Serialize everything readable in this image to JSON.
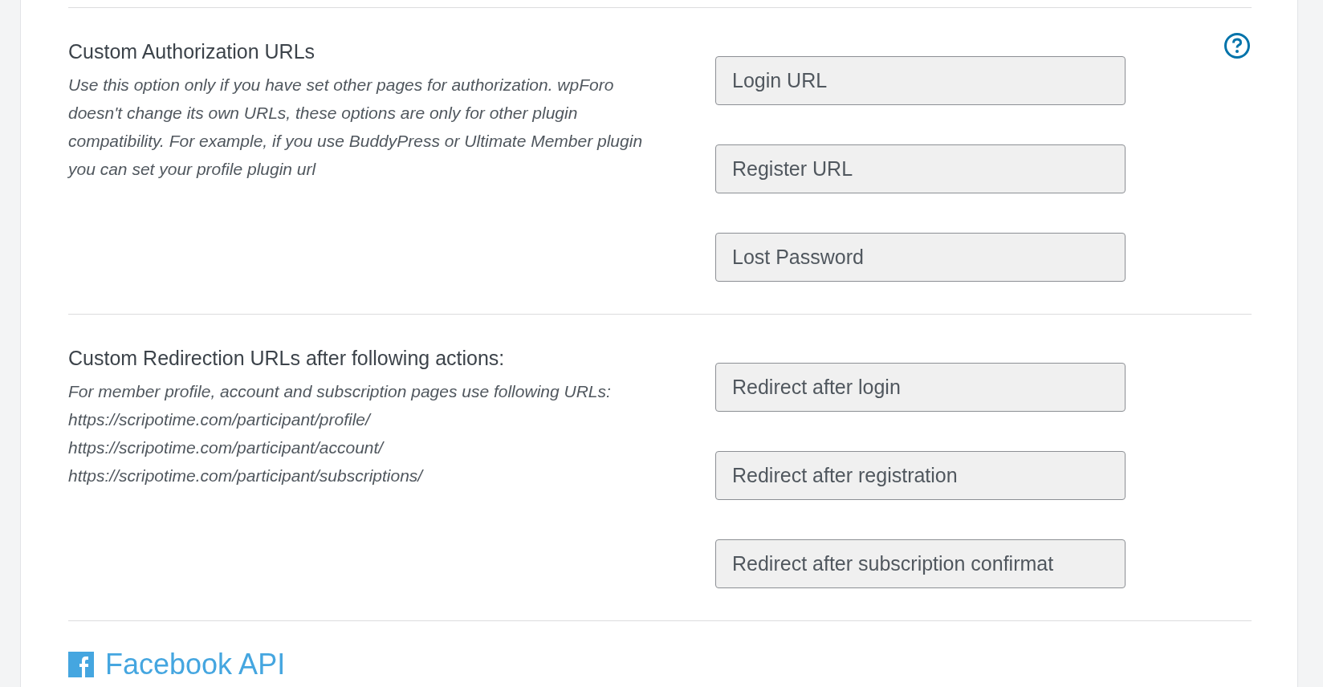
{
  "sections": [
    {
      "title": "Custom Authorization URLs",
      "description": "Use this option only if you have set other pages for authorization. wpForo doesn't change its own URLs, these options are only for other plugin compatibility. For example, if you use BuddyPress or Ultimate Member plugin you can set your profile plugin url",
      "help": true,
      "fields": [
        {
          "value": "Login URL"
        },
        {
          "value": "Register URL"
        },
        {
          "value": "Lost Password"
        }
      ]
    },
    {
      "title": "Custom Redirection URLs after following actions:",
      "description_lines": [
        "For member profile, account and subscription pages use following URLs:",
        "https://scripotime.com/participant/profile/",
        "https://scripotime.com/participant/account/",
        "https://scripotime.com/participant/subscriptions/"
      ],
      "help": false,
      "fields": [
        {
          "value": "Redirect after login"
        },
        {
          "value": "Redirect after registration"
        },
        {
          "value": "Redirect after subscription confirmat"
        }
      ]
    }
  ],
  "next_section": {
    "title": "Facebook API"
  }
}
